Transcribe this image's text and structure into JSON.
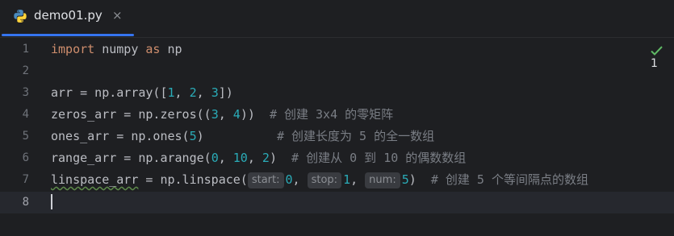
{
  "tab": {
    "filename": "demo01.py",
    "close_glyph": "×",
    "icon": "python-icon"
  },
  "inspection": {
    "count": "1",
    "icon": "check-icon"
  },
  "gutter": {
    "line_numbers": [
      "1",
      "2",
      "3",
      "4",
      "5",
      "6",
      "7",
      "8"
    ],
    "current_line": "8"
  },
  "code": {
    "l1": {
      "kw1": "import",
      "mod": " numpy ",
      "kw2": "as",
      "alias": " np"
    },
    "l3": {
      "a": "arr = np.array([",
      "n1": "1",
      "c1": ", ",
      "n2": "2",
      "c2": ", ",
      "n3": "3",
      "b": "])"
    },
    "l4": {
      "a": "zeros_arr = np.zeros((",
      "n1": "3",
      "c1": ", ",
      "n2": "4",
      "b": "))  ",
      "comment": "# 创建 3x4 的零矩阵"
    },
    "l5": {
      "a": "ones_arr = np.ones(",
      "n1": "5",
      "b": ")          ",
      "comment": "# 创建长度为 5 的全一数组"
    },
    "l6": {
      "a": "range_arr = np.arange(",
      "n1": "0",
      "c1": ", ",
      "n2": "10",
      "c2": ", ",
      "n3": "2",
      "b": ")  ",
      "comment": "# 创建从 0 到 10 的偶数数组"
    },
    "l7": {
      "var": "linspace_arr",
      "a": " = np.linspace(",
      "hint1": "start:",
      "n1": "0",
      "c1": ", ",
      "hint2": "stop:",
      "n2": "1",
      "c2": ", ",
      "hint3": "num:",
      "n3": "5",
      "b": ")  ",
      "comment": "# 创建 5 个等间隔点的数组"
    }
  },
  "colors": {
    "keyword": "#cf8e6d",
    "number": "#2aacb8",
    "comment": "#7a7e85",
    "accent": "#3574f0"
  }
}
